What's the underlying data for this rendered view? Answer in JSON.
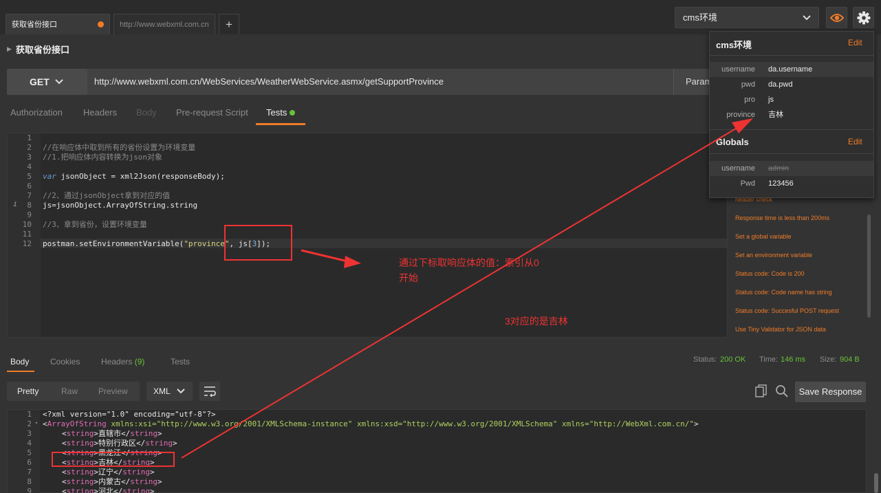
{
  "tabs": [
    {
      "label": "获取省份接口"
    },
    {
      "label": "http://www.webxml.com.cn"
    }
  ],
  "tab_add_label": "+",
  "environment": {
    "selected": "cms环境"
  },
  "request": {
    "title": "获取省份接口",
    "method": "GET",
    "url": "http://www.webxml.com.cn/WebServices/WeatherWebService.asmx/getSupportProvince",
    "params_label": "Params"
  },
  "request_tabs": [
    "Authorization",
    "Headers",
    "Body",
    "Pre-request Script",
    "Tests"
  ],
  "editor": {
    "line_numbers": [
      "1",
      "2",
      "3",
      "4",
      "5",
      "6",
      "7",
      "8",
      "9",
      "10",
      "11",
      "12"
    ],
    "lines": {
      "l2": "//在响应体中取到所有的省份设置为环境变量",
      "l3": "//1.把响应体内容转换为json对象",
      "l5_kw": "var",
      "l5_rest": " jsonObject = xml2Json(responseBody);",
      "l7": "//2、通过jsonObject拿到对应的值",
      "l8": "js=jsonObject.ArrayOfString.string",
      "l10": "//3、拿到省份，设置环境变量",
      "l12_a": "postman.setEnvironmentVariable(",
      "l12_str": "\"province\"",
      "l12_b": ", js[",
      "l12_num": "3",
      "l12_c": "]);"
    },
    "info_marker": "i"
  },
  "snippets": [
    "header check",
    "Response time is less than 200ms",
    "Set a global variable",
    "Set an environment variable",
    "Status code: Code is 200",
    "Status code: Code name has string",
    "Status code: Succesful POST request",
    "Use Tiny Validator for JSON data"
  ],
  "response_tabs": {
    "body": "Body",
    "cookies": "Cookies",
    "headers": "Headers",
    "headers_count": "(9)",
    "tests": "Tests"
  },
  "status": {
    "status_label": "Status:",
    "status_value": "200 OK",
    "time_label": "Time:",
    "time_value": "146 ms",
    "size_label": "Size:",
    "size_value": "904 B"
  },
  "response_toolbar": {
    "pretty": "Pretty",
    "raw": "Raw",
    "preview": "Preview",
    "format": "XML",
    "save": "Save Response"
  },
  "response_lines": {
    "line_numbers": [
      "1",
      "2",
      "3",
      "4",
      "5",
      "6",
      "7",
      "8",
      "9"
    ],
    "l1": "<?xml version=\"1.0\" encoding=\"utf-8\"?>",
    "l2_tag": "ArrayOfString",
    "l2_attrs": " xmlns:xsi=\"http://www.w3.org/2001/XMLSchema-instance\" xmlns:xsd=\"http://www.w3.org/2001/XMLSchema\" xmlns=\"http://WebXml.com.cn/\"",
    "strings": [
      "直辖市",
      "特别行政区",
      "黑龙江",
      "吉林",
      "辽宁",
      "内蒙古",
      "河北"
    ]
  },
  "env_panel": {
    "env_title": "cms环境",
    "edit_label": "Edit",
    "env_vars": [
      {
        "key": "username",
        "value": "da.username"
      },
      {
        "key": "pwd",
        "value": "da.pwd"
      },
      {
        "key": "pro",
        "value": "js"
      },
      {
        "key": "province",
        "value": "吉林"
      }
    ],
    "globals_title": "Globals",
    "global_vars": [
      {
        "key": "username",
        "value": "admin"
      },
      {
        "key": "Pwd",
        "value": "123456"
      }
    ]
  },
  "annotations": {
    "note1_line1": "通过下标取响应体的值：索引从0",
    "note1_line2": "开始",
    "note2": "3对应的是吉林"
  },
  "colors": {
    "accent": "#f07c28",
    "success": "#69c23a",
    "annotation": "#ee3333"
  }
}
